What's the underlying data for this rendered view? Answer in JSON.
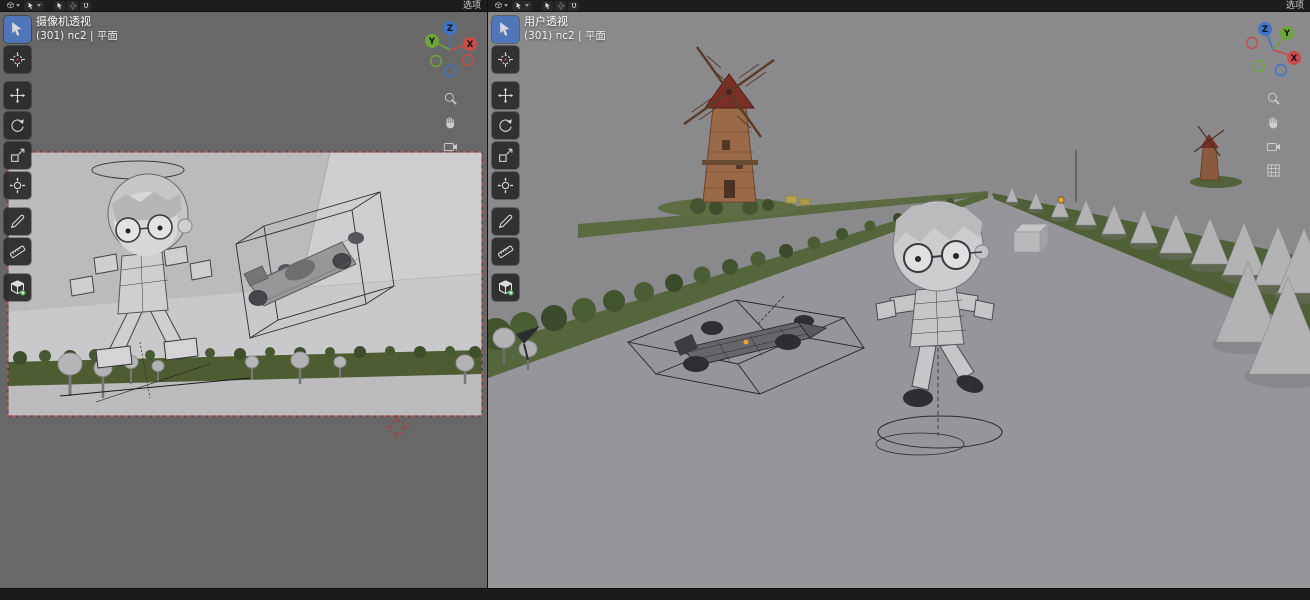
{
  "colors": {
    "axis_x": "#cb4a4a",
    "axis_y": "#6fa33b",
    "axis_z": "#3f74c8",
    "toolbar_active": "#4f76b8"
  },
  "gizmo_labels": {
    "x": "X",
    "y": "Y",
    "z": "Z"
  },
  "left_pane": {
    "header": {
      "options_label": "选项"
    },
    "view_label": "摄像机透视",
    "object_info": "(301) nc2 | 平面",
    "toolbar_icons": [
      "select-box-icon",
      "cursor-icon",
      "move-icon",
      "rotate-icon",
      "scale-icon",
      "transform-icon",
      "annotate-icon",
      "measure-icon",
      "add-cube-icon"
    ],
    "nav_icons": [
      "zoom-icon",
      "pan-hand-icon",
      "camera-view-icon"
    ]
  },
  "right_pane": {
    "header": {
      "options_label": "选项"
    },
    "view_label": "用户透视",
    "object_info": "(301) nc2 | 平面",
    "toolbar_icons": [
      "select-box-icon",
      "cursor-icon",
      "move-icon",
      "rotate-icon",
      "scale-icon",
      "transform-icon",
      "annotate-icon",
      "measure-icon",
      "add-cube-icon"
    ],
    "nav_icons": [
      "zoom-icon",
      "pan-hand-icon",
      "camera-view-icon",
      "grid-ortho-icon"
    ]
  }
}
